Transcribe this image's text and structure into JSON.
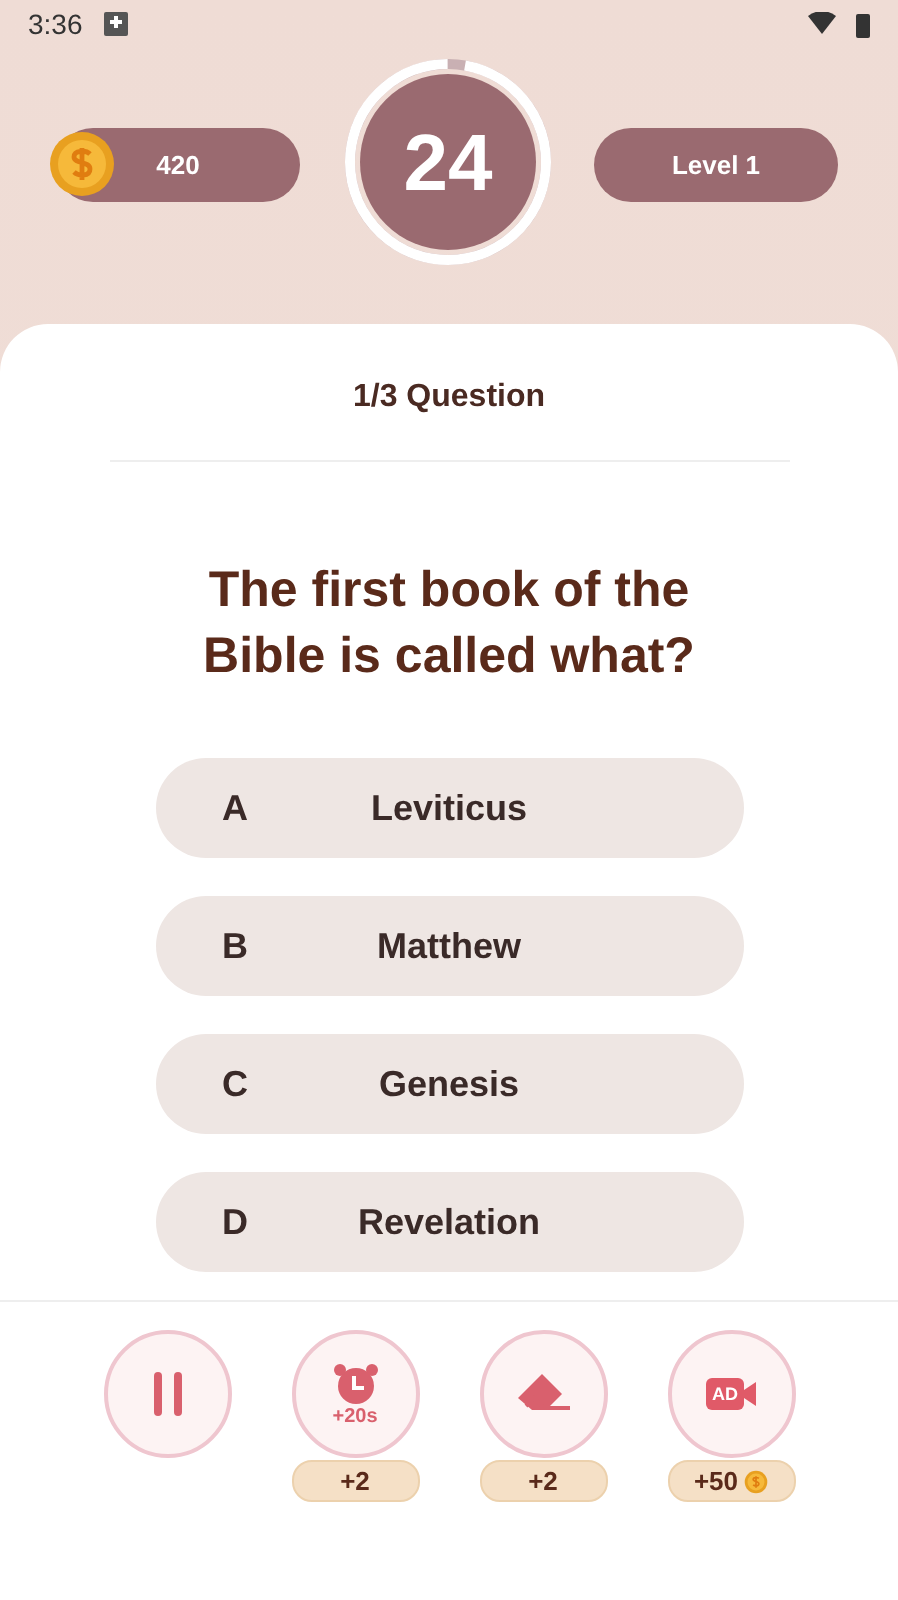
{
  "status_bar": {
    "time": "3:36"
  },
  "header": {
    "coins": "420",
    "timer": {
      "value": "24",
      "level": 0.97
    },
    "level": "Level 1"
  },
  "question": {
    "counter": "1/3 Question",
    "text": "The first book of the Bible is called what?"
  },
  "options": [
    {
      "letter": "A",
      "answer": "Leviticus",
      "selected": false
    },
    {
      "letter": "B",
      "answer": "Matthew",
      "selected": false
    },
    {
      "letter": "C",
      "answer": "Genesis",
      "selected": false
    },
    {
      "letter": "D",
      "answer": "Revelation",
      "selected": false
    }
  ],
  "tools": [
    {
      "kind": "pause"
    },
    {
      "kind": "time",
      "label": "+20s",
      "badge": "+2"
    },
    {
      "kind": "eraser",
      "badge": "+2"
    },
    {
      "kind": "ad",
      "label": "AD",
      "badge": "+50",
      "coin": true
    }
  ]
}
